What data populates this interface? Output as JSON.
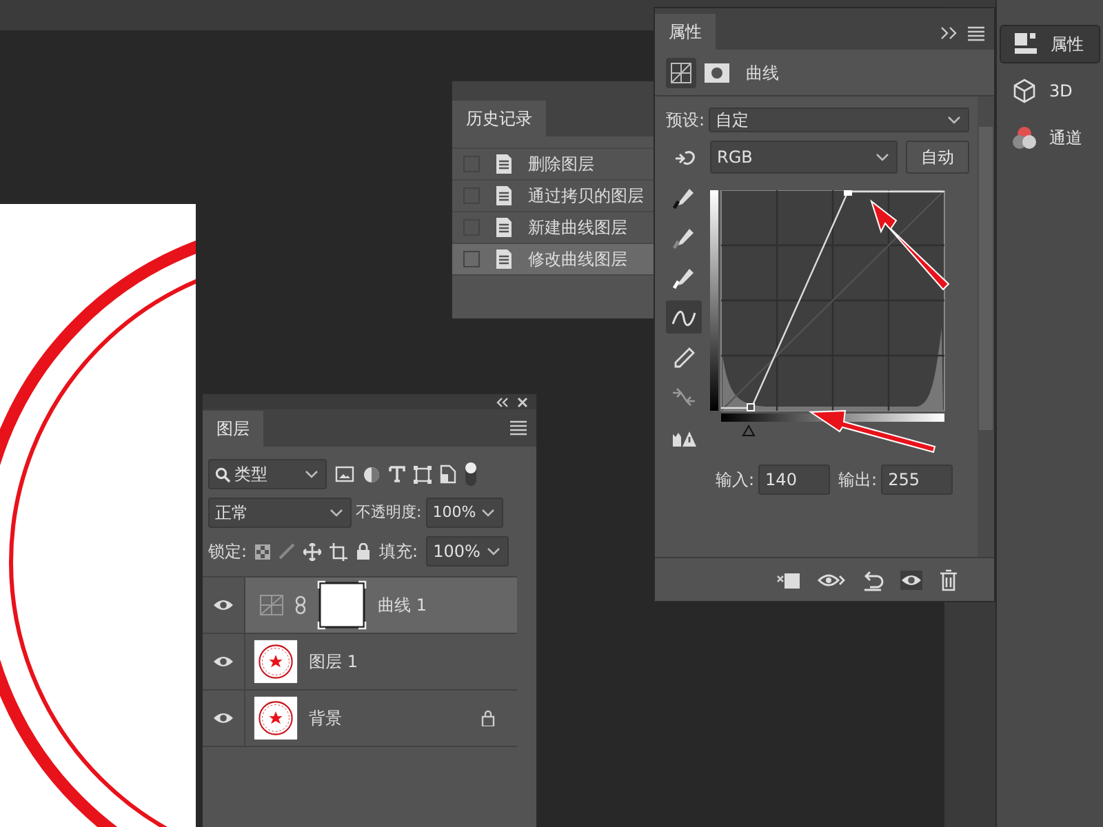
{
  "history": {
    "title": "历史记录",
    "items": [
      {
        "label": "删除图层",
        "selected": false
      },
      {
        "label": "通过拷贝的图层",
        "selected": false
      },
      {
        "label": "新建曲线图层",
        "selected": false
      },
      {
        "label": "修改曲线图层",
        "selected": true
      }
    ]
  },
  "properties": {
    "title": "属性",
    "adjustment": "曲线",
    "preset_label": "预设:",
    "preset": "自定",
    "channel": "RGB",
    "auto_button": "自动",
    "tools": [
      {
        "kind": "target",
        "selected": false
      },
      {
        "kind": "black",
        "selected": false
      },
      {
        "kind": "gray",
        "selected": false
      },
      {
        "kind": "white",
        "selected": false
      },
      {
        "kind": "curve",
        "selected": true
      },
      {
        "kind": "pencil",
        "selected": false
      },
      {
        "kind": "smooth",
        "selected": false
      },
      {
        "kind": "clipping",
        "selected": false
      }
    ],
    "input_label": "输入:",
    "input": "140",
    "output_label": "输出:",
    "output": "255"
  },
  "layers": {
    "title": "图层",
    "filter": "类型",
    "blend_mode": "正常",
    "opacity_label": "不透明度:",
    "opacity": "100%",
    "lock_label": "锁定:",
    "fill_label": "填充:",
    "fill": "100%",
    "items": [
      {
        "name": "曲线 1",
        "kind": "adjustment",
        "selected": true,
        "visible": true,
        "locked": false
      },
      {
        "name": "图层 1",
        "kind": "image",
        "selected": false,
        "visible": true,
        "locked": false
      },
      {
        "name": "背景",
        "kind": "image",
        "selected": false,
        "visible": true,
        "locked": true
      }
    ]
  },
  "dock": {
    "items": [
      {
        "label": "属性",
        "kind": "properties",
        "selected": true
      },
      {
        "label": "3D",
        "kind": "cube",
        "selected": false
      },
      {
        "label": "通道",
        "kind": "channels",
        "selected": false
      }
    ]
  }
}
